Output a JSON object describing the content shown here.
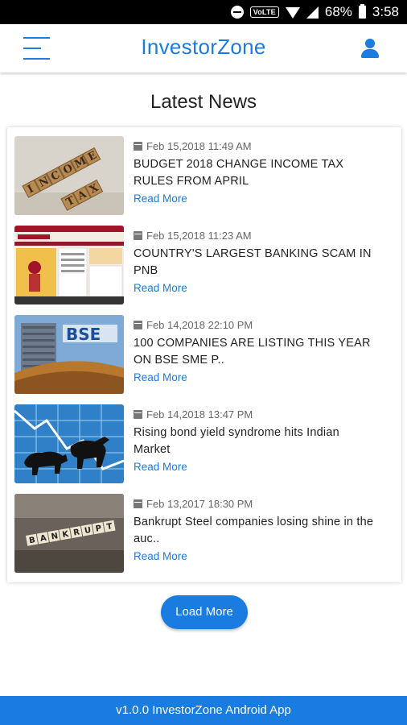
{
  "status_bar": {
    "volte": "VoLTE",
    "battery": "68%",
    "time": "3:58"
  },
  "header": {
    "title": "InvestorZone",
    "menu_icon": "menu-icon",
    "profile_icon": "user-icon"
  },
  "page": {
    "heading": "Latest News"
  },
  "news": [
    {
      "date": "Feb 15,2018 11:49 AM",
      "headline": "BUDGET 2018 CHANGE INCOME TAX RULES FROM APRIL",
      "read_more": "Read More",
      "thumb": "INCOME TAX"
    },
    {
      "date": "Feb 15,2018 11:23 AM",
      "headline": "COUNTRY'S LARGEST BANKING SCAM IN PNB",
      "read_more": "Read More",
      "thumb": "PNB website"
    },
    {
      "date": "Feb 14,2018 22:10 PM",
      "headline": "100 COMPANIES ARE LISTING THIS YEAR ON BSE SME P..",
      "read_more": "Read More",
      "thumb": "BSE"
    },
    {
      "date": "Feb 14,2018 13:47 PM",
      "headline": "Rising bond yield syndrome hits Indian Market",
      "read_more": "Read More",
      "thumb": "bull and bear"
    },
    {
      "date": "Feb 13,2017 18:30 PM",
      "headline": "Bankrupt Steel companies losing shine in the auc..",
      "read_more": "Read More",
      "thumb": "BANKRUPT"
    }
  ],
  "load_more": "Load More",
  "footer": "v1.0.0 InvestorZone Android App",
  "colors": {
    "accent": "#1a7be0",
    "status_bar": "#000000"
  }
}
